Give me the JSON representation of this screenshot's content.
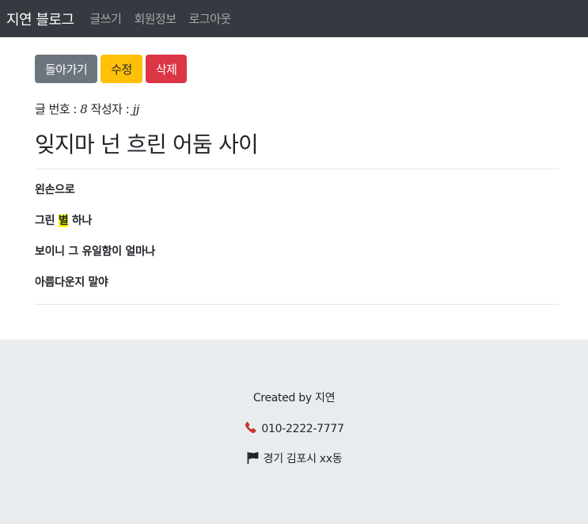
{
  "navbar": {
    "brand": "지연 블로그",
    "links": [
      "글쓰기",
      "회원정보",
      "로그아웃"
    ]
  },
  "actions": {
    "back": "돌아가기",
    "edit": "수정",
    "delete": "삭제"
  },
  "post": {
    "number_label": "글 번호 : ",
    "number": "8",
    "author_label": " 작성자 : ",
    "author": "jj",
    "title": "잊지마 넌 흐린 어둠 사이",
    "lines": {
      "l1": "왼손으로",
      "l2_before": "그린 ",
      "l2_highlight": "별",
      "l2_after": " 하나",
      "l3": "보이니 그 유일함이 얼마나",
      "l4": "아름다운지 말야"
    }
  },
  "footer": {
    "created": "Created by 지연",
    "phone": "010-2222-7777",
    "address": "경기 김포시 xx동",
    "icons": [
      "phone-icon",
      "flag-icon"
    ]
  },
  "colors": {
    "navbar": "#343a40",
    "secondary": "#6c757d",
    "warning": "#ffc107",
    "danger": "#dc3545",
    "highlight": "#ffff00",
    "footer_bg": "#e9ecef",
    "phone_icon": "#c0392b"
  }
}
